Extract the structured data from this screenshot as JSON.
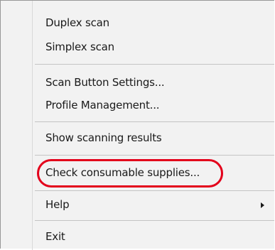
{
  "menu": {
    "items": [
      {
        "label": "Duplex scan"
      },
      {
        "label": "Simplex scan"
      },
      {
        "label": "Scan Button Settings..."
      },
      {
        "label": "Profile Management..."
      },
      {
        "label": "Show scanning results"
      },
      {
        "label": "Check consumable supplies..."
      },
      {
        "label": "Help"
      },
      {
        "label": "Exit"
      }
    ]
  },
  "colors": {
    "highlight": "#e3001b",
    "menu_background": "#f2f2f2"
  }
}
